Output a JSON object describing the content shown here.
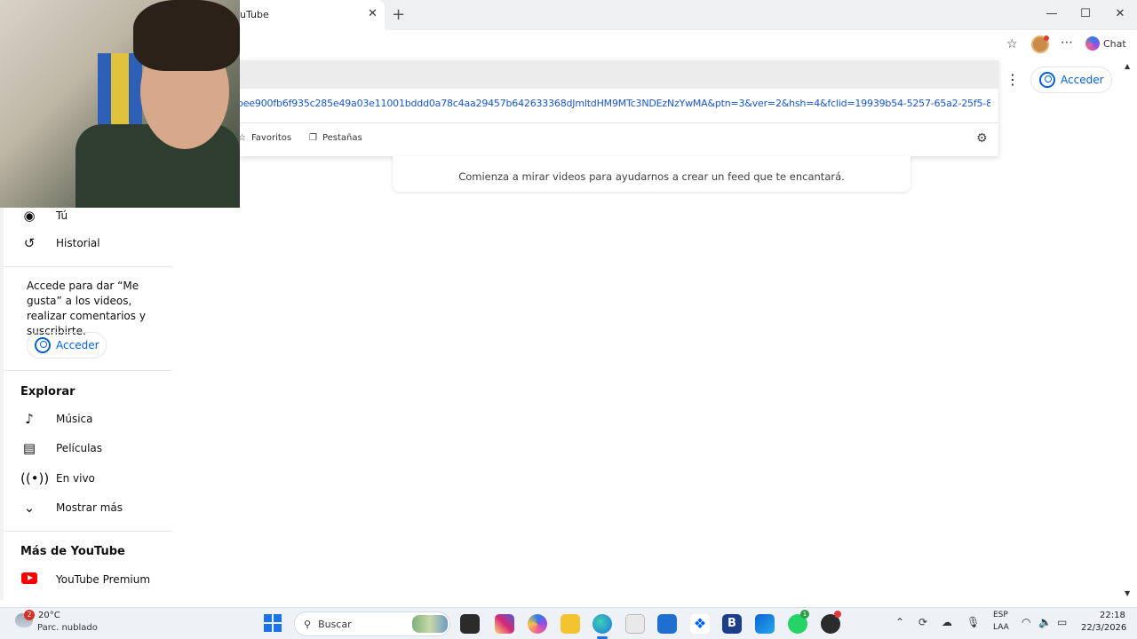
{
  "browser": {
    "tab_title": "uTube",
    "tab_close": "✕",
    "new_tab": "+",
    "window_controls": [
      "—",
      "☐",
      "✕"
    ],
    "chat_label": "Chat",
    "address_url": "bee900fb6f935c285e49a03e11001bddd0a78c4aa29457b642633368dJmltdHM9MTc3NDEzNzYwMA&ptn=3&ver=2&hsh=4&fclid=19939b54-5257-65a2-25f5-8c71...",
    "favorites_label": "Favoritos",
    "tabs_label": "Pestañas"
  },
  "youtube": {
    "signin_label": "Acceder",
    "empty_feed_text": "Comienza a mirar videos para ayudarnos a crear un feed que te encantará.",
    "sidebar": {
      "you_label": "Tú",
      "history_label": "Historial",
      "signin_note": "Accede para dar “Me gusta” a los videos, realizar comentarios y suscribirte.",
      "signin_label": "Acceder",
      "explore_heading": "Explorar",
      "explore_items": [
        "Música",
        "Películas",
        "En vivo",
        "Mostrar más"
      ],
      "more_heading": "Más de YouTube",
      "premium_label": "YouTube Premium"
    }
  },
  "taskbar": {
    "weather_badge": "2",
    "temperature": "20°C",
    "weather_desc": "Parc. nublado",
    "search_label": "Buscar",
    "whatsapp_badge": "1",
    "lang_line1": "ESP",
    "lang_line2": "LAA",
    "time": "22:18",
    "date": "22/3/2026"
  }
}
